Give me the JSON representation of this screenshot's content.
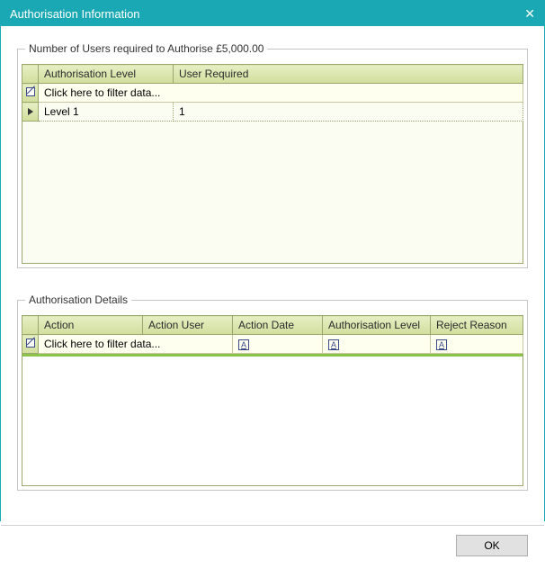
{
  "window": {
    "title": "Authorisation Information",
    "close_label": "✕"
  },
  "group1": {
    "legend": "Number of Users required to Authorise £5,000.00",
    "columns": {
      "c1": "Authorisation Level",
      "c2": "User Required"
    },
    "filter_text": "Click here to filter data...",
    "row1": {
      "level": "Level 1",
      "users": "1"
    }
  },
  "group2": {
    "legend": "Authorisation Details",
    "columns": {
      "c1": "Action",
      "c2": "Action User",
      "c3": "Action Date",
      "c4": "Authorisation Level",
      "c5": "Reject Reason"
    },
    "filter_text": "Click here to filter data..."
  },
  "footer": {
    "ok": "OK"
  }
}
